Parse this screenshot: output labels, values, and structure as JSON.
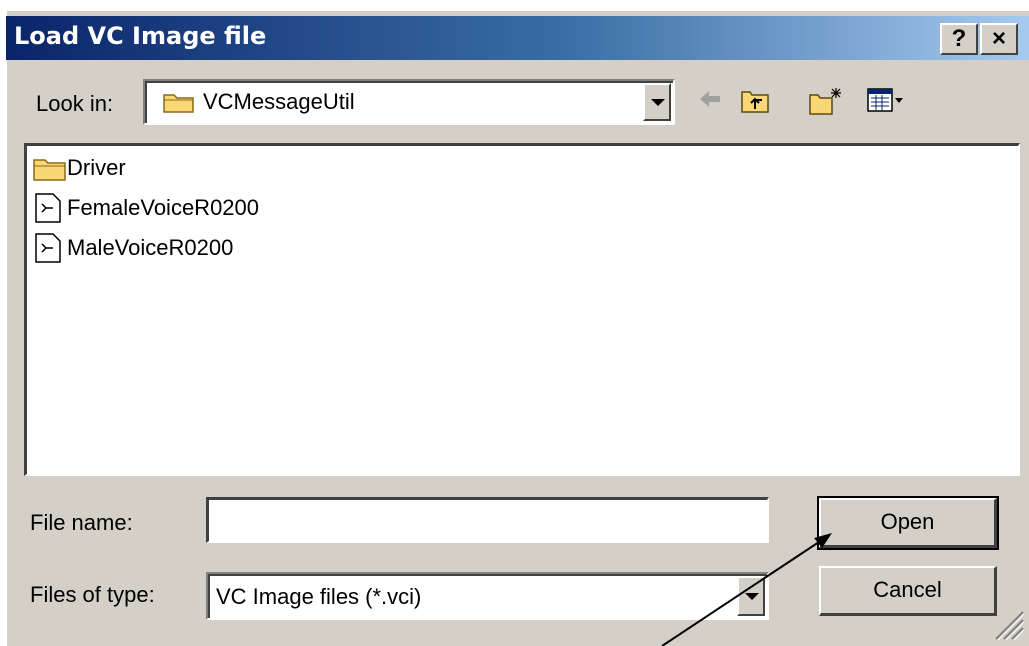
{
  "window": {
    "title": "Load VC Image file",
    "help_label": "?",
    "close_label": "×"
  },
  "look_in": {
    "label": "Look in:",
    "value": "VCMessageUtil"
  },
  "toolbar": [
    "back-icon",
    "up-folder-icon",
    "new-folder-icon",
    "view-menu-icon"
  ],
  "files": [
    {
      "name": "Driver",
      "icon": "folder-icon"
    },
    {
      "name": "FemaleVoiceR0200",
      "icon": "file-icon"
    },
    {
      "name": "MaleVoiceR0200",
      "icon": "file-icon"
    }
  ],
  "file_name": {
    "label": "File name:",
    "value": ""
  },
  "file_type": {
    "label": "Files of type:",
    "value": "VC Image files (*.vci)"
  },
  "buttons": {
    "open": "Open",
    "cancel": "Cancel"
  },
  "colors": {
    "title_start": "#0a246a",
    "title_end": "#a6caf0",
    "face": "#d4d0c8"
  }
}
